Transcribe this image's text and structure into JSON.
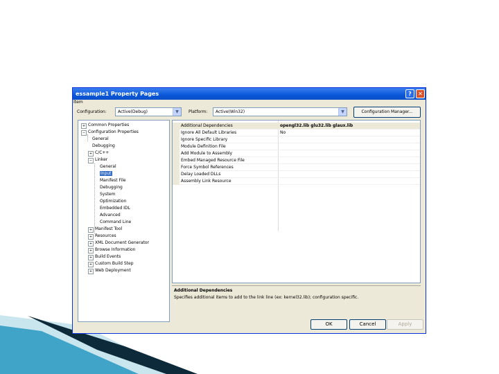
{
  "dialog": {
    "title": "essample1 Property Pages",
    "subtitle": "Item",
    "help_glyph": "?",
    "close_glyph": "✕"
  },
  "config": {
    "configuration_label": "Configuration:",
    "configuration_value": "Active(Debug)",
    "platform_label": "Platform:",
    "platform_value": "Active(Win32)",
    "manager_button": "Configuration Manager...",
    "arrow_glyph": "▼"
  },
  "tree": {
    "items": [
      {
        "label": "Common Properties",
        "toggle": "+"
      },
      {
        "label": "Configuration Properties",
        "toggle": "−"
      },
      {
        "label": "General"
      },
      {
        "label": "Debugging"
      },
      {
        "label": "C/C++",
        "toggle": "+"
      },
      {
        "label": "Linker",
        "toggle": "−"
      },
      {
        "label": "General"
      },
      {
        "label": "Input"
      },
      {
        "label": "Manifest File"
      },
      {
        "label": "Debugging"
      },
      {
        "label": "System"
      },
      {
        "label": "Optimization"
      },
      {
        "label": "Embedded IDL"
      },
      {
        "label": "Advanced"
      },
      {
        "label": "Command Line"
      },
      {
        "label": "Manifest Tool",
        "toggle": "+"
      },
      {
        "label": "Resources",
        "toggle": "+"
      },
      {
        "label": "XML Document Generator",
        "toggle": "+"
      },
      {
        "label": "Browse Information",
        "toggle": "+"
      },
      {
        "label": "Build Events",
        "toggle": "+"
      },
      {
        "label": "Custom Build Step",
        "toggle": "+"
      },
      {
        "label": "Web Deployment",
        "toggle": "+"
      }
    ]
  },
  "grid": {
    "rows": [
      {
        "name": "Additional Dependencies",
        "value": "opengl32.lib glu32.lib glaux.lib"
      },
      {
        "name": "Ignore All Default Libraries",
        "value": "No"
      },
      {
        "name": "Ignore Specific Library",
        "value": ""
      },
      {
        "name": "Module Definition File",
        "value": ""
      },
      {
        "name": "Add Module to Assembly",
        "value": ""
      },
      {
        "name": "Embed Managed Resource File",
        "value": ""
      },
      {
        "name": "Force Symbol References",
        "value": ""
      },
      {
        "name": "Delay Loaded DLLs",
        "value": ""
      },
      {
        "name": "Assembly Link Resource",
        "value": ""
      }
    ]
  },
  "description": {
    "title": "Additional Dependencies",
    "text": "Specifies additional items to add to the link line (ex: kernel32.lib); configuration specific."
  },
  "buttons": {
    "ok": "OK",
    "cancel": "Cancel",
    "apply": "Apply"
  },
  "colors": {
    "titlebar": "#0a57d8",
    "selection": "#316ac5",
    "dialog_bg": "#ece9d8"
  }
}
